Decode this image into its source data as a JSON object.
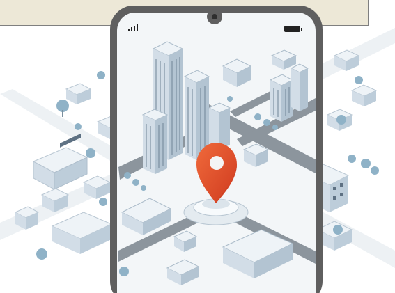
{
  "colors": {
    "banner": "#ede8d7",
    "banner_border": "#7f7f7f",
    "phone_frame": "#5f5f5f",
    "phone_screen": "#f3f6f8",
    "road": "#8c959d",
    "building_light": "#eef3f7",
    "building_mid": "#d7e1ea",
    "building_dark": "#9fb3c4",
    "window": "#5e7183",
    "tree": "#8fb2c7",
    "pin": "#ea4e2e",
    "pin_dark": "#c13c22"
  },
  "icons": {
    "signal": "signal-bars-icon",
    "battery": "battery-icon",
    "camera": "camera-notch-icon",
    "location": "location-pin-icon"
  }
}
